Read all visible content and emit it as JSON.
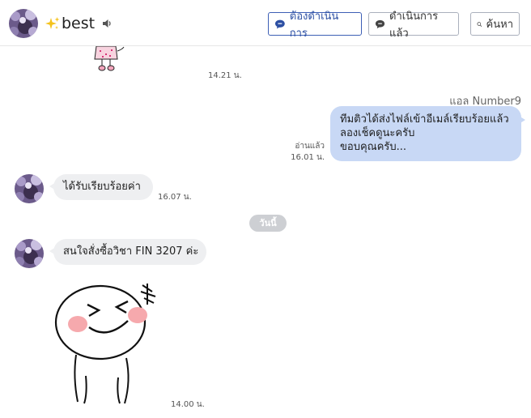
{
  "header": {
    "title": "best",
    "title_prefix_icon": "sparkle-icon",
    "sound_icon": "speaker-icon",
    "buttons": {
      "todo_label": "ต้องดำเนินการ",
      "done_label": "ดำเนินการแล้ว",
      "search_label": "ค้นหา"
    },
    "colors": {
      "primary": "#2c4fa3",
      "border": "#aab0bc"
    }
  },
  "messages": {
    "sticker_top_time": "14.21 น.",
    "outgoing": {
      "sender": "แอล Number9",
      "lines": [
        "ทีมติวได้ส่งไฟล์เข้าอีเมล์เรียบร้อยแล้ว",
        "ลองเช็คดูนะครับ",
        "ขอบคุณครับ..."
      ],
      "read_status": "อ่านแล้ว",
      "time": "16.01 น.",
      "bubble_color": "#c8d8f5"
    },
    "incoming_1": {
      "text": "ได้รับเรียบร้อยค่า",
      "time": "16.07 น."
    },
    "date_separator": "วันนี้",
    "incoming_2": {
      "text": "สนใจสั่งซื้อวิชา FIN 3207 ค่ะ"
    },
    "sticker_time": "14.00 น.",
    "incoming_bubble_color": "#eeeff1"
  }
}
